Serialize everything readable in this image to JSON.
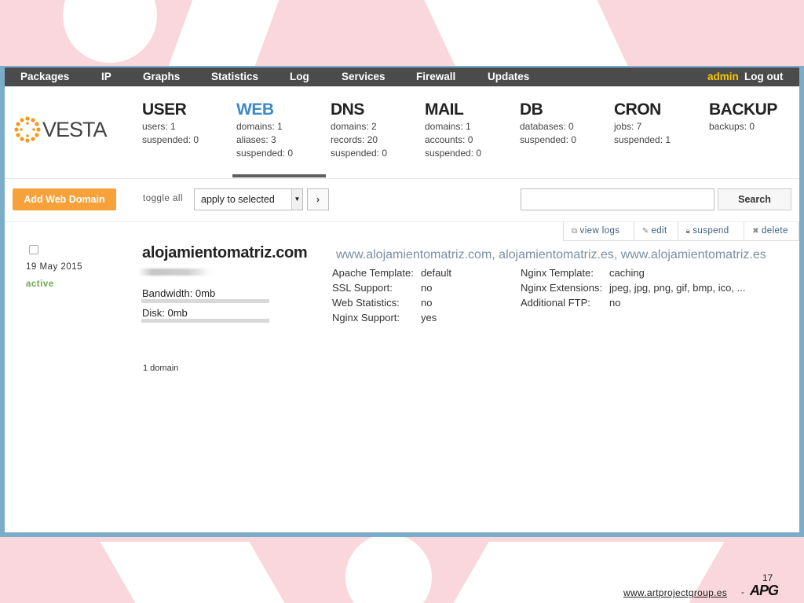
{
  "topnav": {
    "items": [
      "Packages",
      "IP",
      "Graphs",
      "Statistics",
      "Log",
      "Services",
      "Firewall",
      "Updates"
    ],
    "user": "admin",
    "logout": "Log out"
  },
  "logo": {
    "text": "VESTA"
  },
  "stats": [
    {
      "title": "USER",
      "lines": [
        "users: 1",
        "suspended: 0"
      ]
    },
    {
      "title": "WEB",
      "lines": [
        "domains: 1",
        "aliases: 3",
        "suspended: 0"
      ]
    },
    {
      "title": "DNS",
      "lines": [
        "domains: 2",
        "records: 20",
        "suspended: 0"
      ]
    },
    {
      "title": "MAIL",
      "lines": [
        "domains: 1",
        "accounts: 0",
        "suspended: 0"
      ]
    },
    {
      "title": "DB",
      "lines": [
        "databases: 0",
        "suspended: 0"
      ]
    },
    {
      "title": "CRON",
      "lines": [
        "jobs: 7",
        "suspended: 1"
      ]
    },
    {
      "title": "BACKUP",
      "lines": [
        "backups: 0"
      ]
    }
  ],
  "toolbar": {
    "add_label": "Add Web Domain",
    "toggle_all": "toggle all",
    "apply_select": "apply to selected",
    "go_label": "›",
    "search_label": "Search"
  },
  "actions": {
    "view_logs": "view logs",
    "edit": "edit",
    "suspend": "suspend",
    "delete": "delete"
  },
  "domain": {
    "date": "19 May 2015",
    "status": "active",
    "name": "alojamientomatriz.com",
    "aliases": "www.alojamientomatriz.com, alojamientomatriz.es, www.alojamientomatriz.es",
    "bandwidth": "Bandwidth: 0mb",
    "bandwidth_fraction": 0,
    "disk": "Disk: 0mb",
    "disk_fraction": 0,
    "left_details": [
      {
        "key": "Apache Template:",
        "value": "default"
      },
      {
        "key": "SSL Support:",
        "value": "no"
      },
      {
        "key": "Web Statistics:",
        "value": "no"
      },
      {
        "key": "Nginx Support:",
        "value": "yes"
      }
    ],
    "right_details": [
      {
        "key": "Nginx Template:",
        "value": "caching"
      },
      {
        "key": "Nginx Extensions:",
        "value": "jpeg, jpg, png, gif, bmp, ico, ..."
      },
      {
        "key": "Additional FTP:",
        "value": "no"
      }
    ]
  },
  "summary": "1 domain",
  "footer": {
    "page_number": "17",
    "link": "www.artprojectgroup.es",
    "dash": "-",
    "logo": "APG"
  },
  "colors": {
    "accent": "#3d8ac4",
    "orange_button": "#f7a13a",
    "topnav_bg": "#4b4b4b",
    "admin": "#f9c600",
    "status_active": "#6aa84f",
    "background": "#f9d7dc"
  }
}
